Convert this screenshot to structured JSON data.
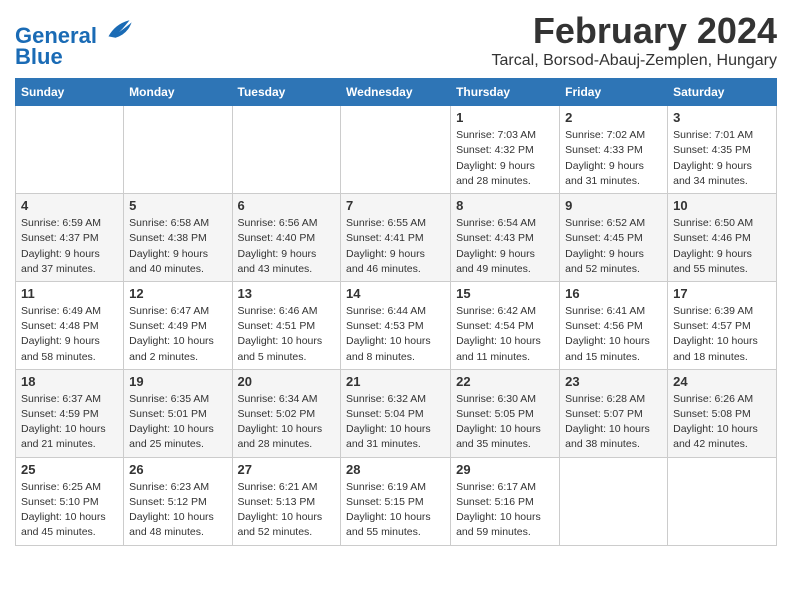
{
  "header": {
    "logo_line1": "General",
    "logo_line2": "Blue",
    "main_title": "February 2024",
    "subtitle": "Tarcal, Borsod-Abauj-Zemplen, Hungary"
  },
  "days_of_week": [
    "Sunday",
    "Monday",
    "Tuesday",
    "Wednesday",
    "Thursday",
    "Friday",
    "Saturday"
  ],
  "weeks": [
    [
      {
        "day": "",
        "info": ""
      },
      {
        "day": "",
        "info": ""
      },
      {
        "day": "",
        "info": ""
      },
      {
        "day": "",
        "info": ""
      },
      {
        "day": "1",
        "info": "Sunrise: 7:03 AM\nSunset: 4:32 PM\nDaylight: 9 hours and 28 minutes."
      },
      {
        "day": "2",
        "info": "Sunrise: 7:02 AM\nSunset: 4:33 PM\nDaylight: 9 hours and 31 minutes."
      },
      {
        "day": "3",
        "info": "Sunrise: 7:01 AM\nSunset: 4:35 PM\nDaylight: 9 hours and 34 minutes."
      }
    ],
    [
      {
        "day": "4",
        "info": "Sunrise: 6:59 AM\nSunset: 4:37 PM\nDaylight: 9 hours and 37 minutes."
      },
      {
        "day": "5",
        "info": "Sunrise: 6:58 AM\nSunset: 4:38 PM\nDaylight: 9 hours and 40 minutes."
      },
      {
        "day": "6",
        "info": "Sunrise: 6:56 AM\nSunset: 4:40 PM\nDaylight: 9 hours and 43 minutes."
      },
      {
        "day": "7",
        "info": "Sunrise: 6:55 AM\nSunset: 4:41 PM\nDaylight: 9 hours and 46 minutes."
      },
      {
        "day": "8",
        "info": "Sunrise: 6:54 AM\nSunset: 4:43 PM\nDaylight: 9 hours and 49 minutes."
      },
      {
        "day": "9",
        "info": "Sunrise: 6:52 AM\nSunset: 4:45 PM\nDaylight: 9 hours and 52 minutes."
      },
      {
        "day": "10",
        "info": "Sunrise: 6:50 AM\nSunset: 4:46 PM\nDaylight: 9 hours and 55 minutes."
      }
    ],
    [
      {
        "day": "11",
        "info": "Sunrise: 6:49 AM\nSunset: 4:48 PM\nDaylight: 9 hours and 58 minutes."
      },
      {
        "day": "12",
        "info": "Sunrise: 6:47 AM\nSunset: 4:49 PM\nDaylight: 10 hours and 2 minutes."
      },
      {
        "day": "13",
        "info": "Sunrise: 6:46 AM\nSunset: 4:51 PM\nDaylight: 10 hours and 5 minutes."
      },
      {
        "day": "14",
        "info": "Sunrise: 6:44 AM\nSunset: 4:53 PM\nDaylight: 10 hours and 8 minutes."
      },
      {
        "day": "15",
        "info": "Sunrise: 6:42 AM\nSunset: 4:54 PM\nDaylight: 10 hours and 11 minutes."
      },
      {
        "day": "16",
        "info": "Sunrise: 6:41 AM\nSunset: 4:56 PM\nDaylight: 10 hours and 15 minutes."
      },
      {
        "day": "17",
        "info": "Sunrise: 6:39 AM\nSunset: 4:57 PM\nDaylight: 10 hours and 18 minutes."
      }
    ],
    [
      {
        "day": "18",
        "info": "Sunrise: 6:37 AM\nSunset: 4:59 PM\nDaylight: 10 hours and 21 minutes."
      },
      {
        "day": "19",
        "info": "Sunrise: 6:35 AM\nSunset: 5:01 PM\nDaylight: 10 hours and 25 minutes."
      },
      {
        "day": "20",
        "info": "Sunrise: 6:34 AM\nSunset: 5:02 PM\nDaylight: 10 hours and 28 minutes."
      },
      {
        "day": "21",
        "info": "Sunrise: 6:32 AM\nSunset: 5:04 PM\nDaylight: 10 hours and 31 minutes."
      },
      {
        "day": "22",
        "info": "Sunrise: 6:30 AM\nSunset: 5:05 PM\nDaylight: 10 hours and 35 minutes."
      },
      {
        "day": "23",
        "info": "Sunrise: 6:28 AM\nSunset: 5:07 PM\nDaylight: 10 hours and 38 minutes."
      },
      {
        "day": "24",
        "info": "Sunrise: 6:26 AM\nSunset: 5:08 PM\nDaylight: 10 hours and 42 minutes."
      }
    ],
    [
      {
        "day": "25",
        "info": "Sunrise: 6:25 AM\nSunset: 5:10 PM\nDaylight: 10 hours and 45 minutes."
      },
      {
        "day": "26",
        "info": "Sunrise: 6:23 AM\nSunset: 5:12 PM\nDaylight: 10 hours and 48 minutes."
      },
      {
        "day": "27",
        "info": "Sunrise: 6:21 AM\nSunset: 5:13 PM\nDaylight: 10 hours and 52 minutes."
      },
      {
        "day": "28",
        "info": "Sunrise: 6:19 AM\nSunset: 5:15 PM\nDaylight: 10 hours and 55 minutes."
      },
      {
        "day": "29",
        "info": "Sunrise: 6:17 AM\nSunset: 5:16 PM\nDaylight: 10 hours and 59 minutes."
      },
      {
        "day": "",
        "info": ""
      },
      {
        "day": "",
        "info": ""
      }
    ]
  ]
}
